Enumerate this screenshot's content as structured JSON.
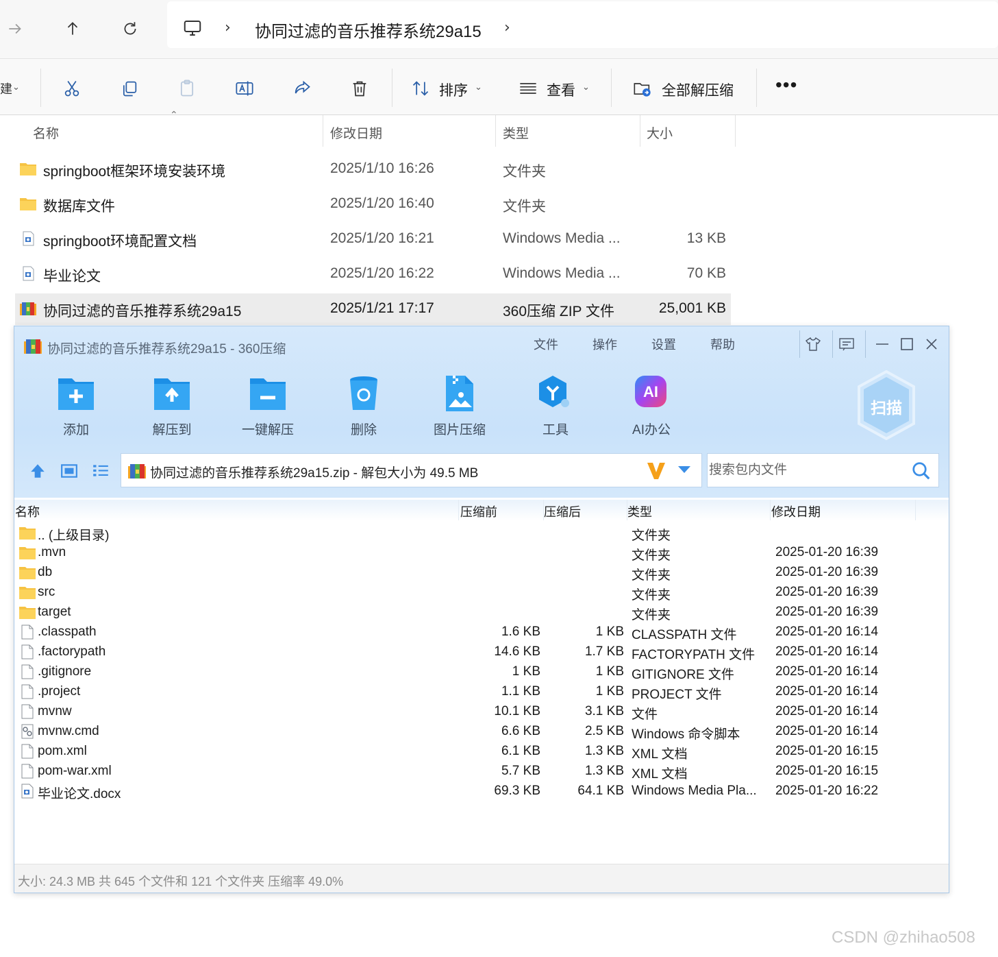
{
  "explorer": {
    "address": {
      "folder": "协同过滤的音乐推荐系统29a15"
    },
    "command_bar": {
      "sort_label": "排序",
      "view_label": "查看",
      "extract_all_label": "全部解压缩"
    },
    "columns": {
      "name": "名称",
      "date": "修改日期",
      "type": "类型",
      "size": "大小"
    },
    "rows": [
      {
        "name": "springboot框架环境安装环境",
        "date": "2025/1/10 16:26",
        "type": "文件夹",
        "size": "",
        "icon": "folder-icon"
      },
      {
        "name": "数据库文件",
        "date": "2025/1/20 16:40",
        "type": "文件夹",
        "size": "",
        "icon": "folder-icon"
      },
      {
        "name": "springboot环境配置文档",
        "date": "2025/1/20 16:21",
        "type": "Windows Media ...",
        "size": "13 KB",
        "icon": "document-icon"
      },
      {
        "name": "毕业论文",
        "date": "2025/1/20 16:22",
        "type": "Windows Media ...",
        "size": "70 KB",
        "icon": "document-icon"
      },
      {
        "name": "协同过滤的音乐推荐系统29a15",
        "date": "2025/1/21 17:17",
        "type": "360压缩 ZIP 文件",
        "size": "25,001 KB",
        "icon": "zip-archive-icon",
        "selected": true
      }
    ]
  },
  "zip_window": {
    "title": "协同过滤的音乐推荐系统29a15 - 360压缩",
    "menu": [
      "文件",
      "操作",
      "设置",
      "帮助"
    ],
    "tools": [
      {
        "label": "添加",
        "icon": "add-icon"
      },
      {
        "label": "解压到",
        "icon": "extract-to-icon"
      },
      {
        "label": "一键解压",
        "icon": "one-click-extract-icon"
      },
      {
        "label": "删除",
        "icon": "delete-icon"
      },
      {
        "label": "图片压缩",
        "icon": "image-compress-icon"
      },
      {
        "label": "工具",
        "icon": "tools-icon"
      },
      {
        "label": "AI办公",
        "icon": "ai-office-icon"
      }
    ],
    "scan_label": "扫描",
    "path_text": "协同过滤的音乐推荐系统29a15.zip - 解包大小为 49.5 MB",
    "search_placeholder": "搜索包内文件",
    "columns": {
      "name": "名称",
      "before": "压缩前",
      "after": "压缩后",
      "type": "类型",
      "date": "修改日期"
    },
    "rows": [
      {
        "name": ".. (上级目录)",
        "before": "",
        "after": "",
        "type": "文件夹",
        "date": "",
        "icon": "folder-icon"
      },
      {
        "name": ".mvn",
        "before": "",
        "after": "",
        "type": "文件夹",
        "date": "2025-01-20 16:39",
        "icon": "folder-icon"
      },
      {
        "name": "db",
        "before": "",
        "after": "",
        "type": "文件夹",
        "date": "2025-01-20 16:39",
        "icon": "folder-icon"
      },
      {
        "name": "src",
        "before": "",
        "after": "",
        "type": "文件夹",
        "date": "2025-01-20 16:39",
        "icon": "folder-icon"
      },
      {
        "name": "target",
        "before": "",
        "after": "",
        "type": "文件夹",
        "date": "2025-01-20 16:39",
        "icon": "folder-icon"
      },
      {
        "name": ".classpath",
        "before": "1.6 KB",
        "after": "1 KB",
        "type": "CLASSPATH 文件",
        "date": "2025-01-20 16:14",
        "icon": "file-icon"
      },
      {
        "name": ".factorypath",
        "before": "14.6 KB",
        "after": "1.7 KB",
        "type": "FACTORYPATH 文件",
        "date": "2025-01-20 16:14",
        "icon": "file-icon"
      },
      {
        "name": ".gitignore",
        "before": "1 KB",
        "after": "1 KB",
        "type": "GITIGNORE 文件",
        "date": "2025-01-20 16:14",
        "icon": "file-icon"
      },
      {
        "name": ".project",
        "before": "1.1 KB",
        "after": "1 KB",
        "type": "PROJECT 文件",
        "date": "2025-01-20 16:14",
        "icon": "file-icon"
      },
      {
        "name": "mvnw",
        "before": "10.1 KB",
        "after": "3.1 KB",
        "type": "文件",
        "date": "2025-01-20 16:14",
        "icon": "file-icon"
      },
      {
        "name": "mvnw.cmd",
        "before": "6.6 KB",
        "after": "2.5 KB",
        "type": "Windows 命令脚本",
        "date": "2025-01-20 16:14",
        "icon": "script-icon"
      },
      {
        "name": "pom.xml",
        "before": "6.1 KB",
        "after": "1.3 KB",
        "type": "XML 文档",
        "date": "2025-01-20 16:15",
        "icon": "file-icon"
      },
      {
        "name": "pom-war.xml",
        "before": "5.7 KB",
        "after": "1.3 KB",
        "type": "XML 文档",
        "date": "2025-01-20 16:15",
        "icon": "file-icon"
      },
      {
        "name": "毕业论文.docx",
        "before": "69.3 KB",
        "after": "64.1 KB",
        "type": "Windows Media Pla...",
        "date": "2025-01-20 16:22",
        "icon": "document-icon"
      }
    ],
    "status": "大小: 24.3 MB 共 645 个文件和 121 个文件夹 压缩率 49.0%"
  },
  "watermark": "CSDN @zhihao508"
}
